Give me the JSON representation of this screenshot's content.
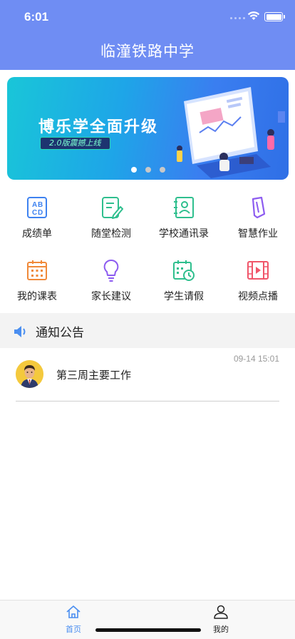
{
  "status_bar": {
    "time": "6:01"
  },
  "header": {
    "title": "临潼铁路中学"
  },
  "banner": {
    "title": "博乐学全面升级",
    "subtitle": "2.0版震撼上线",
    "slide_count": 3,
    "active_slide": 1
  },
  "grid": {
    "items": [
      {
        "label": "成绩单",
        "icon": "abcd-icon",
        "color": "#3e82f0"
      },
      {
        "label": "随堂检测",
        "icon": "edit-doc-icon",
        "color": "#2fbf8e"
      },
      {
        "label": "学校通讯录",
        "icon": "contact-book-icon",
        "color": "#2fbf8e"
      },
      {
        "label": "智慧作业",
        "icon": "homework-icon",
        "color": "#8d5cf0"
      },
      {
        "label": "我的课表",
        "icon": "calendar-icon",
        "color": "#f08a3a"
      },
      {
        "label": "家长建议",
        "icon": "lightbulb-icon",
        "color": "#8d5cf0"
      },
      {
        "label": "学生请假",
        "icon": "leave-calendar-icon",
        "color": "#2fbf8e"
      },
      {
        "label": "视频点播",
        "icon": "video-icon",
        "color": "#f0566a"
      }
    ]
  },
  "notice": {
    "heading": "通知公告",
    "items": [
      {
        "time": "09-14 15:01",
        "text": "第三周主要工作"
      }
    ]
  },
  "tabbar": {
    "home_label": "首页",
    "me_label": "我的",
    "active_color": "#4a8ef0"
  }
}
